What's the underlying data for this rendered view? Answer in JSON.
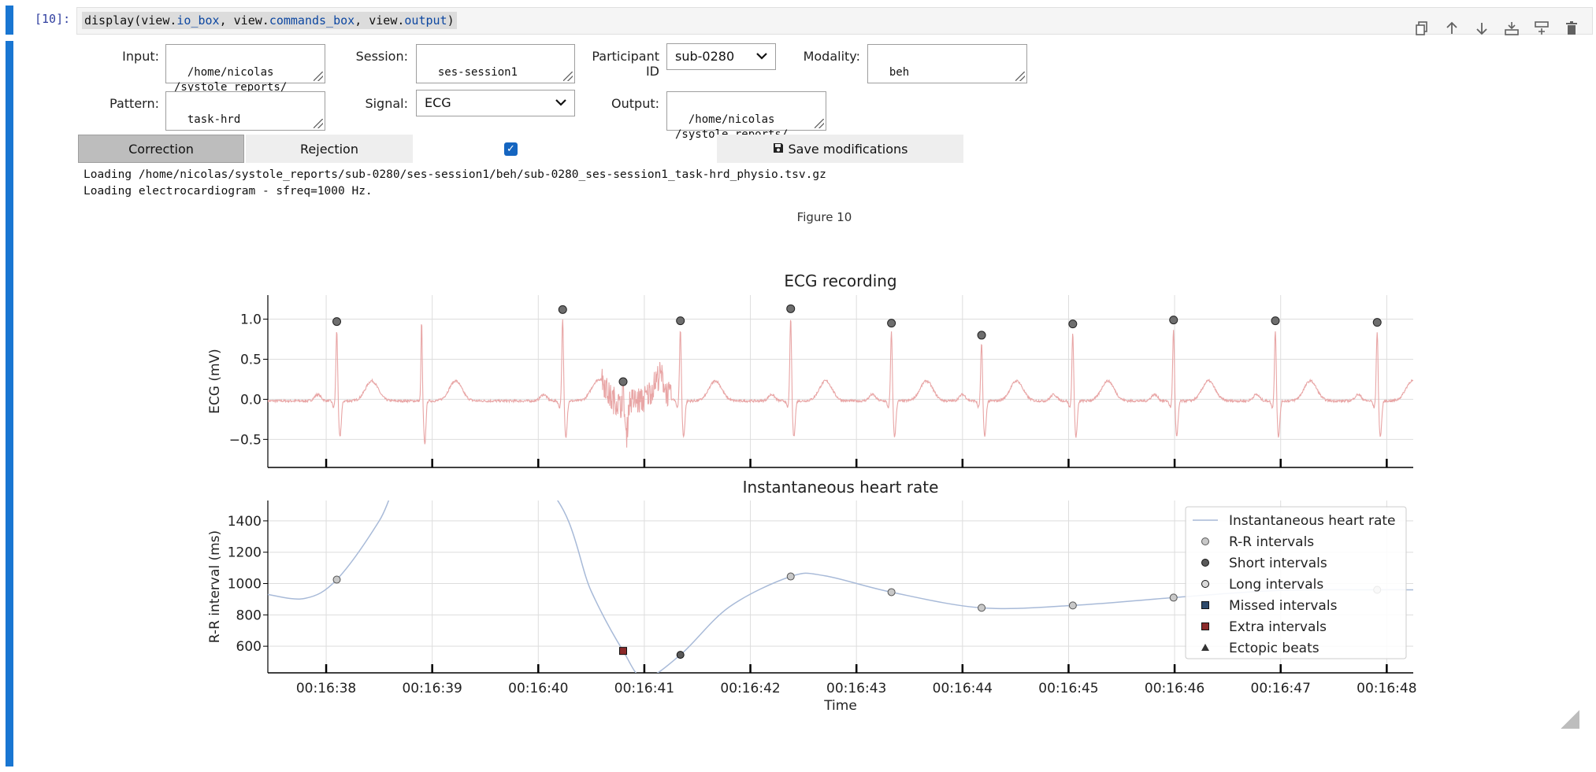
{
  "cell": {
    "prompt": "[10]:",
    "code": {
      "prefix": "display(view.",
      "attr1": "io_box",
      "sep1": ", view.",
      "attr2": "commands_box",
      "sep2": ", view.",
      "attr3": "output",
      "suffix": ")"
    },
    "toolbar_icons": [
      "copy-icon",
      "arrow-up-icon",
      "arrow-down-icon",
      "insert-above-icon",
      "insert-below-icon",
      "delete-icon"
    ]
  },
  "form": {
    "input_label": "Input:",
    "input_value": "/home/nicolas\n/systole_reports/",
    "session_label": "Session:",
    "session_value": "ses-session1",
    "participant_label": "Participant ID",
    "participant_value": "sub-0280",
    "modality_label": "Modality:",
    "modality_value": "beh",
    "pattern_label": "Pattern:",
    "pattern_value": "task-hrd",
    "signal_label": "Signal:",
    "signal_value": "ECG",
    "output_label": "Output:",
    "output_value": "/home/nicolas\n/systole_reports/"
  },
  "commands": {
    "correction_label": "Correction",
    "rejection_label": "Rejection",
    "checkbox_checked": true,
    "save_label": "Save modifications"
  },
  "log": [
    "Loading /home/nicolas/systole_reports/sub-0280/ses-session1/beh/sub-0280_ses-session1_task-hrd_physio.tsv.gz",
    "Loading electrocardiogram - sfreq=1000 Hz."
  ],
  "figure_title": "Figure 10",
  "colors": {
    "accent": "#1976d2",
    "ecg_line": "#e8a5a5",
    "hr_line": "#a8bad8",
    "peak_marker": "#6e6e6e",
    "extra_marker": "#8b2a2a",
    "missed_marker": "#2e4a6b"
  },
  "chart_data": [
    {
      "type": "line",
      "title": "ECG recording",
      "xlabel": "",
      "ylabel": "ECG (mV)",
      "ylim": [
        -0.85,
        1.3
      ],
      "xlim": [
        37.45,
        48.25
      ],
      "yticks": [
        "−0.5",
        "0.0",
        "0.5",
        "1.0"
      ],
      "ytick_values": [
        -0.5,
        0.0,
        0.5,
        1.0
      ],
      "grid": true,
      "r_peak_times": [
        38.1,
        40.23,
        40.8,
        41.34,
        42.38,
        43.33,
        44.18,
        45.04,
        45.99,
        46.95,
        47.91
      ],
      "r_peak_values": [
        0.97,
        1.12,
        0.22,
        0.98,
        1.13,
        0.95,
        0.8,
        0.94,
        0.99,
        0.98,
        0.96
      ]
    },
    {
      "type": "line",
      "title": "Instantaneous heart rate",
      "xlabel": "Time",
      "ylabel": "R-R interval (ms)",
      "ylim": [
        430,
        1530
      ],
      "xlim": [
        37.45,
        48.25
      ],
      "yticks": [
        "600",
        "800",
        "1000",
        "1200",
        "1400"
      ],
      "ytick_values": [
        600,
        800,
        1000,
        1200,
        1400
      ],
      "xticks": [
        "00:16:38",
        "00:16:39",
        "00:16:40",
        "00:16:41",
        "00:16:42",
        "00:16:43",
        "00:16:44",
        "00:16:45",
        "00:16:46",
        "00:16:47",
        "00:16:48"
      ],
      "grid": true,
      "legend_position": "top-right",
      "series": [
        {
          "name": "Instantaneous heart rate",
          "x": [
            37.45,
            37.8,
            38.1,
            38.5,
            39.0,
            40.1,
            40.5,
            40.8,
            41.0,
            41.34,
            41.8,
            42.38,
            42.7,
            43.33,
            44.18,
            45.04,
            45.99,
            46.95,
            47.91,
            48.25
          ],
          "y": [
            930,
            905,
            1025,
            1400,
            2000,
            1600,
            950,
            570,
            400,
            545,
            850,
            1045,
            1050,
            945,
            845,
            860,
            910,
            955,
            960,
            960
          ]
        },
        {
          "name": "R-R intervals",
          "x": [
            38.1,
            42.38,
            43.33,
            44.18,
            45.04,
            45.99,
            47.91
          ],
          "y": [
            1025,
            1045,
            945,
            845,
            860,
            910,
            960
          ]
        },
        {
          "name": "Short intervals",
          "x": [
            41.34
          ],
          "y": [
            545
          ]
        },
        {
          "name": "Long intervals",
          "x": [],
          "y": []
        },
        {
          "name": "Missed intervals",
          "x": [],
          "y": []
        },
        {
          "name": "Extra intervals",
          "x": [
            40.8
          ],
          "y": [
            570
          ]
        },
        {
          "name": "Ectopic beats",
          "x": [],
          "y": []
        }
      ]
    }
  ]
}
